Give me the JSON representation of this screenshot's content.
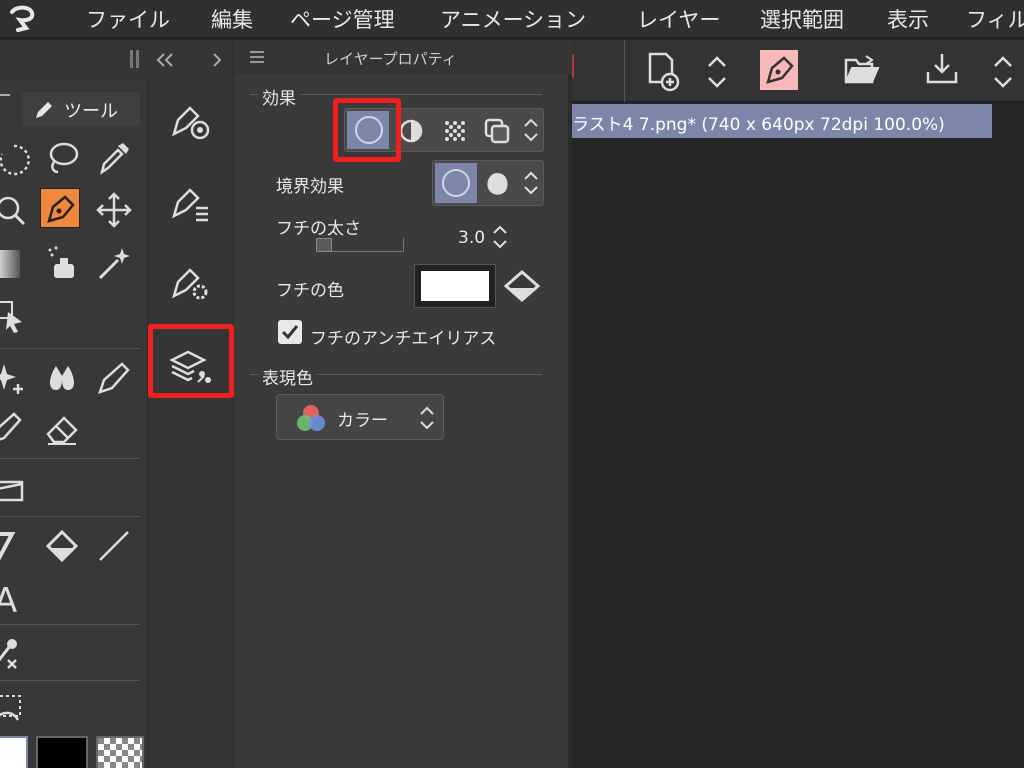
{
  "menu": {
    "items": [
      "ファイル",
      "編集",
      "ページ管理",
      "アニメーション",
      "レイヤー",
      "選択範囲",
      "表示",
      "フィル"
    ]
  },
  "tool_palette": {
    "tab_label": "ツール"
  },
  "canvas_tab": {
    "title": "ラスト4 7.png* (740 x 640px 72dpi 100.0%)"
  },
  "layer_property": {
    "title": "レイヤープロパティ",
    "effects_section": "効果",
    "border_effect_label": "境界効果",
    "edge_width_label": "フチの太さ",
    "edge_width_value": "3.0",
    "edge_color_label": "フチの色",
    "edge_color_value": "#ffffff",
    "antialias_label": "フチのアンチエイリアス",
    "antialias_checked": true,
    "expression_section": "表現色",
    "expression_value": "カラー"
  },
  "colors": {
    "accent_selected": "#7c86a8",
    "tool_selected": "#f0883c",
    "highlight_box": "#ee2020"
  },
  "icons": {
    "app_logo": "clip-studio-logo-icon",
    "pen_tool": "pen-nib-icon",
    "layer_effect": "layer-property-icon"
  }
}
